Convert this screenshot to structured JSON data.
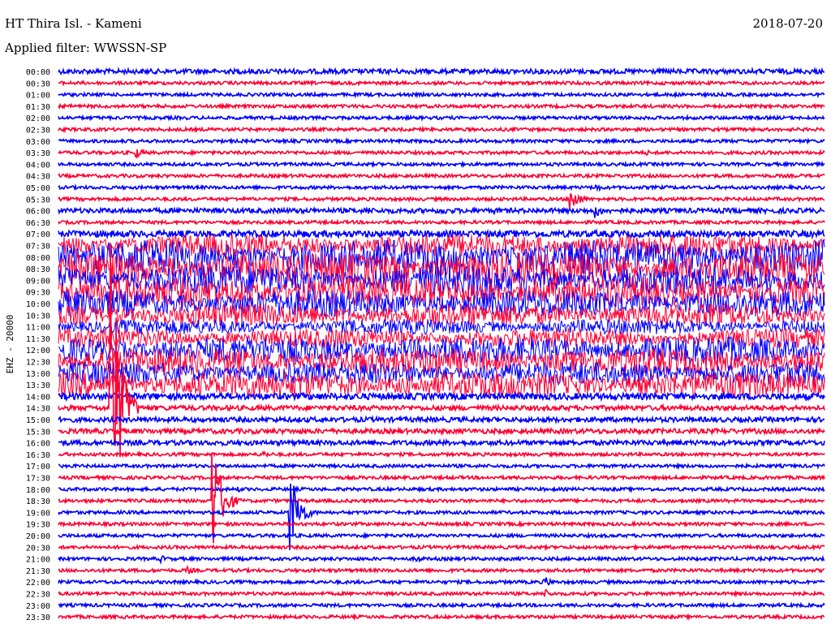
{
  "header": {
    "station": "HT Thira Isl. - Kameni",
    "date": "2018-07-20",
    "filter": "Applied filter: WWSSN-SP"
  },
  "chart_data": {
    "type": "line",
    "title": "HT Thira Isl. - Kameni",
    "ylabel": "EHZ - 20000",
    "colors": {
      "even_row": "#0000ff",
      "odd_row": "#ff0033"
    },
    "row_labels": [
      "00:00",
      "00:30",
      "01:00",
      "01:30",
      "02:00",
      "02:30",
      "03:00",
      "03:30",
      "04:00",
      "04:30",
      "05:00",
      "05:30",
      "06:00",
      "06:30",
      "07:00",
      "07:30",
      "08:00",
      "08:30",
      "09:00",
      "09:30",
      "10:00",
      "10:30",
      "11:00",
      "11:30",
      "12:00",
      "12:30",
      "13:00",
      "13:30",
      "14:00",
      "14:30",
      "15:00",
      "15:30",
      "16:00",
      "16:30",
      "17:00",
      "17:30",
      "18:00",
      "18:30",
      "19:00",
      "19:30",
      "20:00",
      "20:30",
      "21:00",
      "21:30",
      "22:00",
      "22:30",
      "23:00",
      "23:30"
    ],
    "row_noise_level": [
      3,
      2,
      2,
      2,
      2,
      2,
      2,
      2,
      2,
      2,
      2,
      2,
      3,
      2,
      4,
      12,
      18,
      18,
      16,
      16,
      14,
      12,
      8,
      10,
      14,
      14,
      12,
      14,
      4,
      3,
      3,
      3,
      3,
      2,
      2,
      2,
      2,
      2,
      2,
      2,
      2,
      2,
      2,
      2,
      2,
      2,
      2,
      2
    ],
    "events": [
      {
        "row": 0,
        "minute": 1,
        "amp": 4
      },
      {
        "row": 0,
        "minute": 3,
        "amp": 4
      },
      {
        "row": 2,
        "minute": 24,
        "amp": 4
      },
      {
        "row": 7,
        "minute": 3,
        "amp": 8
      },
      {
        "row": 7,
        "minute": 23,
        "amp": 4
      },
      {
        "row": 10,
        "minute": 21,
        "amp": 6
      },
      {
        "row": 11,
        "minute": 20,
        "amp": 20
      },
      {
        "row": 12,
        "minute": 12,
        "amp": 8
      },
      {
        "row": 12,
        "minute": 15,
        "amp": 6
      },
      {
        "row": 12,
        "minute": 17,
        "amp": 6
      },
      {
        "row": 12,
        "minute": 21,
        "amp": 10
      },
      {
        "row": 28,
        "minute": 7,
        "amp": 6
      },
      {
        "row": 29,
        "minute": 2,
        "amp": 240
      },
      {
        "row": 31,
        "minute": 4,
        "amp": 4
      },
      {
        "row": 33,
        "minute": 8,
        "amp": 5
      },
      {
        "row": 36,
        "minute": 7,
        "amp": 4
      },
      {
        "row": 37,
        "minute": 6,
        "amp": 90
      },
      {
        "row": 38,
        "minute": 9,
        "amp": 70
      },
      {
        "row": 42,
        "minute": 4,
        "amp": 5
      },
      {
        "row": 42,
        "minute": 14,
        "amp": 5
      },
      {
        "row": 43,
        "minute": 5,
        "amp": 6
      },
      {
        "row": 44,
        "minute": 19,
        "amp": 8
      },
      {
        "row": 45,
        "minute": 19,
        "amp": 7
      }
    ]
  }
}
